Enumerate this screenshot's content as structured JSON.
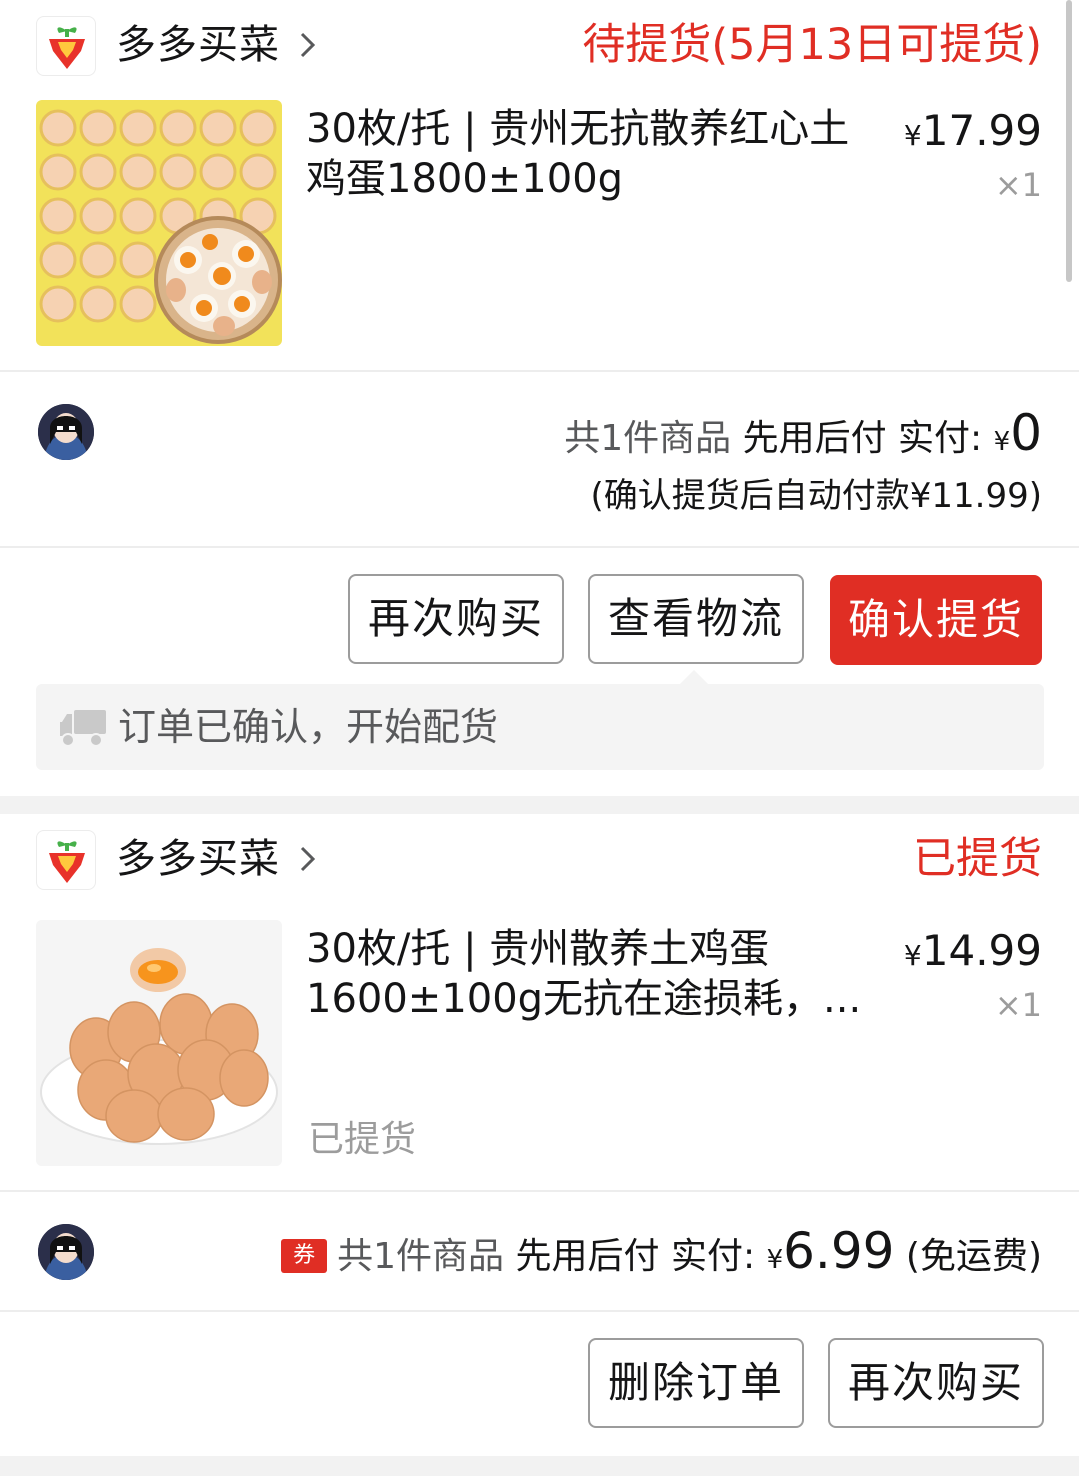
{
  "orders": [
    {
      "store_name": "多多买菜",
      "status": "待提货(5月13日可提货)",
      "product_title": "30枚/托 | 贵州无抗散养红心土鸡蛋1800±100g",
      "price_symbol": "¥",
      "price_value": "17.99",
      "quantity": "×1",
      "summary_count": "共1件商品",
      "summary_paylater": "先用后付",
      "summary_paid_label": "实付:",
      "summary_yen": "¥",
      "summary_amount": "0",
      "auto_pay_note": "(确认提货后自动付款¥11.99)",
      "buttons": [
        "再次购买",
        "查看物流",
        "确认提货"
      ],
      "logistics_text": "订单已确认，开始配货"
    },
    {
      "store_name": "多多买菜",
      "status": "已提货",
      "product_title": "30枚/托 | 贵州散养土鸡蛋1600±100g无抗在途损耗，...",
      "price_symbol": "¥",
      "price_value": "14.99",
      "quantity": "×1",
      "pickup_note": "已提货",
      "coupon_badge": "券",
      "summary_count": "共1件商品",
      "summary_paylater": "先用后付",
      "summary_paid_label": "实付:",
      "summary_yen": "¥",
      "summary_amount": "6.99",
      "shipping_note": "(免运费)",
      "buttons": [
        "删除订单",
        "再次购买"
      ]
    }
  ],
  "colors": {
    "accent": "#e02e24",
    "text": "#151516",
    "muted": "#9c9c9c",
    "background": "#f2f2f2"
  },
  "icons": [
    "carrot-logo-icon",
    "chevron-right-icon",
    "truck-icon",
    "coupon-icon"
  ]
}
